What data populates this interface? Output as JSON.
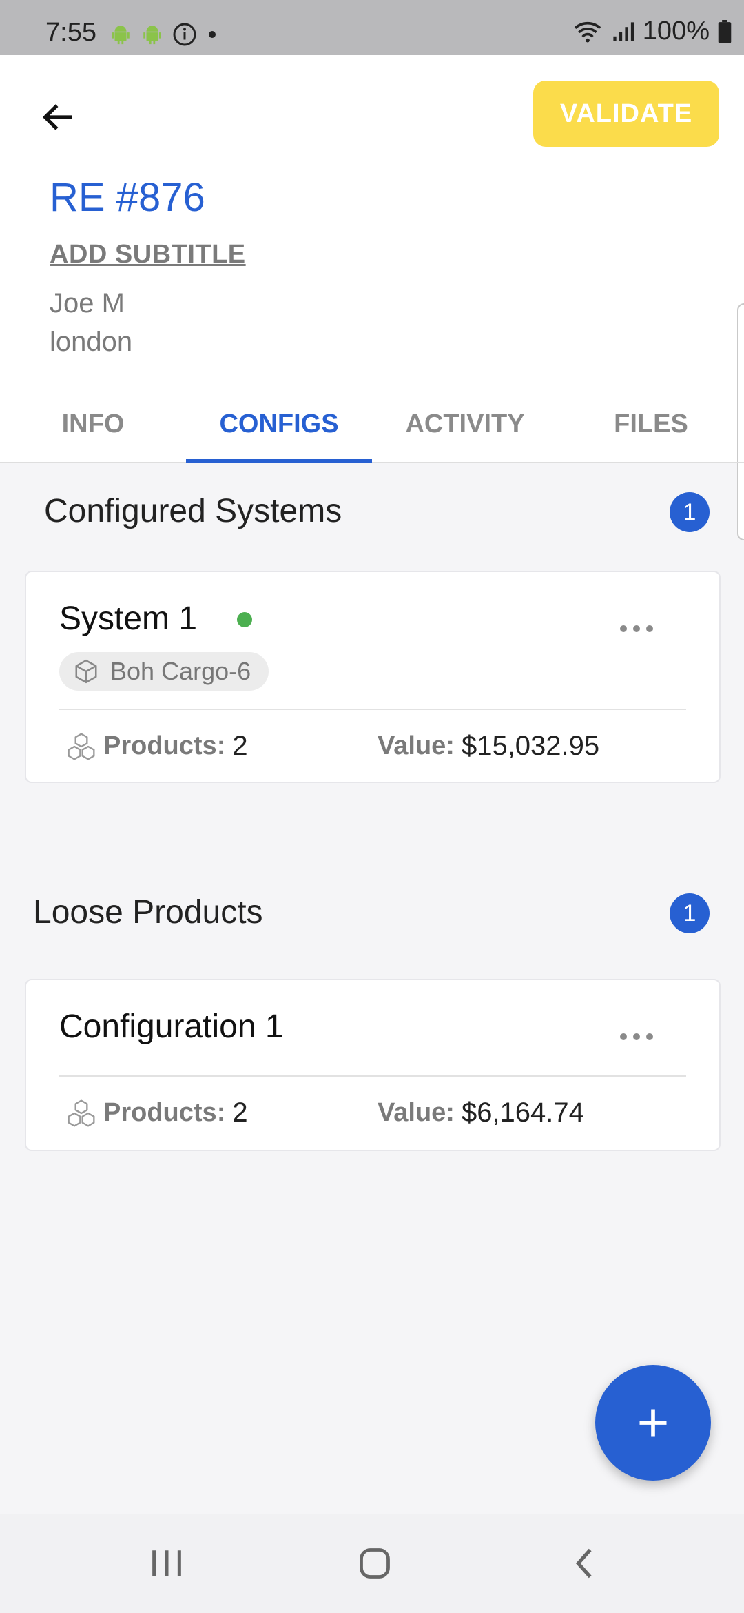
{
  "status_bar": {
    "time": "7:55",
    "battery": "100%",
    "left_icons": [
      "android-icon",
      "android-icon",
      "info-icon",
      "dot-icon"
    ],
    "right_icons": [
      "wifi-icon",
      "signal-icon",
      "battery-icon"
    ]
  },
  "header": {
    "back_icon": "back-arrow-icon",
    "validate_label": "VALIDATE",
    "title": "RE #876",
    "subtitle_action": "ADD SUBTITLE",
    "owner": "Joe M",
    "location": "london"
  },
  "tabs": [
    {
      "label": "INFO",
      "active": false
    },
    {
      "label": "CONFIGS",
      "active": true
    },
    {
      "label": "ACTIVITY",
      "active": false
    },
    {
      "label": "FILES",
      "active": false
    }
  ],
  "configured_systems": {
    "title": "Configured Systems",
    "count": "1",
    "items": [
      {
        "name": "System 1",
        "status_color": "#4caf50",
        "chip_icon": "box-icon",
        "chip_label": "Boh Cargo-6",
        "products_label": "Products:",
        "products_value": "2",
        "value_label": "Value:",
        "value": "$15,032.95"
      }
    ]
  },
  "loose_products": {
    "title": "Loose Products",
    "count": "1",
    "items": [
      {
        "name": "Configuration 1",
        "products_label": "Products:",
        "products_value": "2",
        "value_label": "Value:",
        "value": "$6,164.74"
      }
    ]
  },
  "fab": {
    "icon": "plus-icon"
  },
  "nav_bar": {
    "icons": [
      "recent-apps-icon",
      "home-icon",
      "back-icon"
    ]
  },
  "colors": {
    "accent": "#2760d2",
    "validate": "#fbdc4b",
    "status_active": "#4caf50"
  }
}
